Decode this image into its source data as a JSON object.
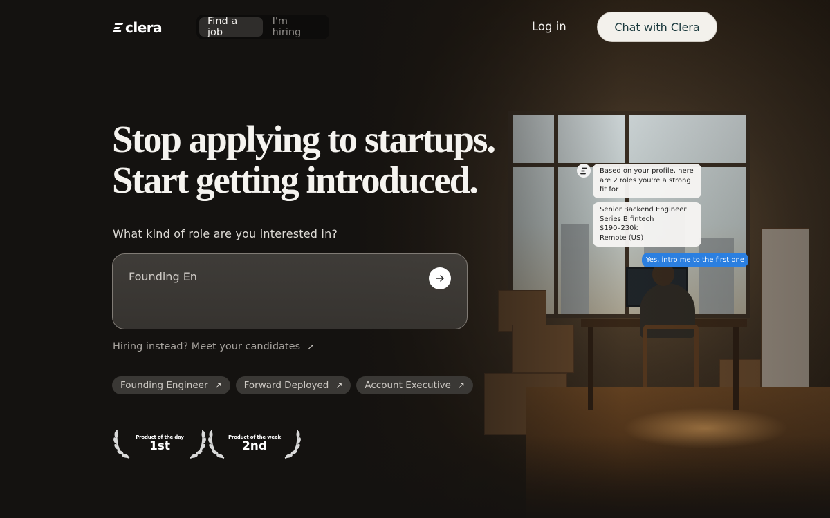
{
  "header": {
    "logo_text": "clera",
    "toggle": {
      "find_job": "Find a job",
      "hiring": "I'm hiring",
      "active": "find_job"
    },
    "login": "Log in",
    "chat_button": "Chat with Clera"
  },
  "hero": {
    "headline_line1": "Stop applying to startups.",
    "headline_line2": "Start getting introduced.",
    "question": "What kind of role are you interested in?",
    "input_value": "Founding En",
    "hiring_link": "Hiring instead? Meet your candidates",
    "chips": [
      "Founding Engineer",
      "Forward Deployed",
      "Account Executive"
    ]
  },
  "badges": [
    {
      "label": "Product of the day",
      "rank": "1st"
    },
    {
      "label": "Product of the week",
      "rank": "2nd"
    }
  ],
  "chat": {
    "message_1": "Based on your profile, here are 2 roles you're a strong fit for",
    "role_title": "Senior Backend Engineer",
    "role_company": "Series B fintech",
    "role_salary": "$190–230k",
    "role_location": "Remote (US)",
    "reply": "Yes, intro me to the first one"
  },
  "colors": {
    "accent": "#2b7fe0",
    "chat_button_text": "#1b3a3e"
  },
  "icons": {
    "submit": "arrow-right-icon",
    "external": "arrow-up-right-icon",
    "laurel": "laurel-icon"
  }
}
